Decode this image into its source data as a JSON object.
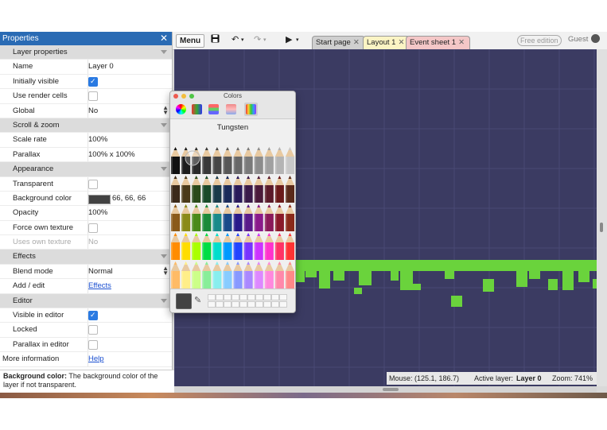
{
  "properties": {
    "title": "Properties",
    "rows": [
      {
        "type": "section",
        "label": "Layer properties"
      },
      {
        "type": "text",
        "label": "Name",
        "value": "Layer 0"
      },
      {
        "type": "check",
        "label": "Initially visible",
        "checked": true
      },
      {
        "type": "check",
        "label": "Use render cells",
        "checked": false
      },
      {
        "type": "select",
        "label": "Global",
        "value": "No"
      },
      {
        "type": "section",
        "label": "Scroll & zoom"
      },
      {
        "type": "text",
        "label": "Scale rate",
        "value": "100%"
      },
      {
        "type": "expand",
        "label": "Parallax",
        "value": "100% x 100%"
      },
      {
        "type": "section",
        "label": "Appearance"
      },
      {
        "type": "check",
        "label": "Transparent",
        "checked": false
      },
      {
        "type": "color",
        "label": "Background color",
        "value": "66, 66, 66"
      },
      {
        "type": "text",
        "label": "Opacity",
        "value": "100%"
      },
      {
        "type": "check",
        "label": "Force own texture",
        "checked": false
      },
      {
        "type": "textdis",
        "label": "Uses own texture",
        "value": "No"
      },
      {
        "type": "section",
        "label": "Effects"
      },
      {
        "type": "select",
        "label": "Blend mode",
        "value": "Normal"
      },
      {
        "type": "link",
        "label": "Add / edit",
        "value": "Effects"
      },
      {
        "type": "section",
        "label": "Editor"
      },
      {
        "type": "check",
        "label": "Visible in editor",
        "checked": true
      },
      {
        "type": "check",
        "label": "Locked",
        "checked": false
      },
      {
        "type": "check",
        "label": "Parallax in editor",
        "checked": false
      },
      {
        "type": "linkroot",
        "label": "More information",
        "value": "Help"
      }
    ],
    "help_title": "Background color:",
    "help_text": "The background color of the layer if not transparent."
  },
  "toolbar": {
    "menu": "Menu",
    "tabs": [
      {
        "label": "Start page",
        "color": "#cfcfcf"
      },
      {
        "label": "Layout 1",
        "color": "#fbf4c4"
      },
      {
        "label": "Event sheet 1",
        "color": "#f4c7c7"
      }
    ],
    "free_edition": "Free edition",
    "guest": "Guest"
  },
  "colors_panel": {
    "title": "Colors",
    "palette_name": "Tungsten",
    "selected_color": "#424242"
  },
  "status": {
    "mouse": "Mouse: (125.1, 186.7)",
    "active_layer_label": "Active layer:",
    "active_layer": "Layer 0",
    "zoom": "Zoom: 741%"
  },
  "colors": {
    "canvas_bg": "#3b3b62",
    "tile_green": "#6ad33c",
    "title_bar": "#2a6bb4"
  }
}
